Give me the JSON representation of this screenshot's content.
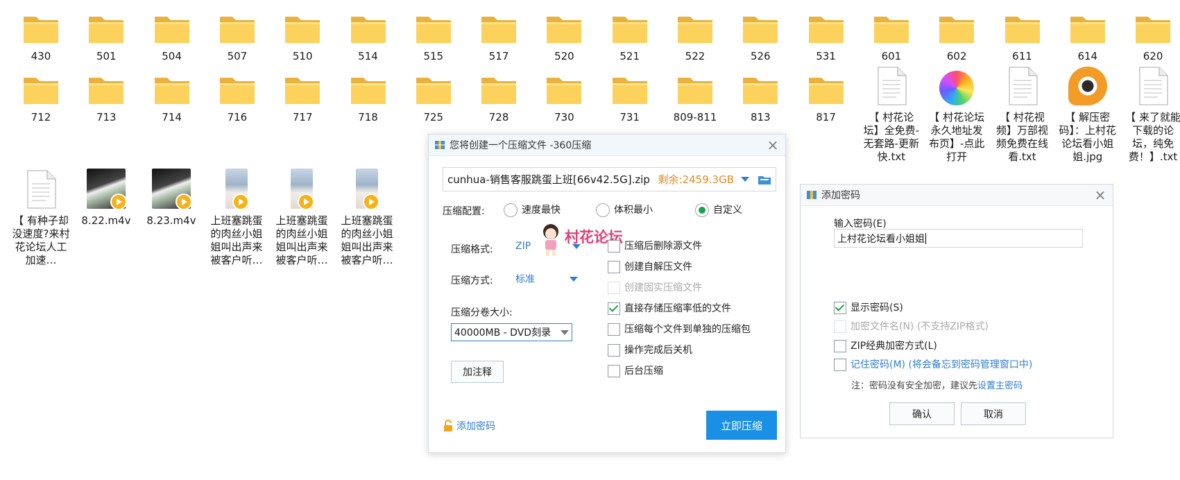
{
  "desktop": {
    "row1": [
      "430",
      "501",
      "504",
      "507",
      "510",
      "514",
      "515",
      "517",
      "520",
      "521",
      "522",
      "526",
      "531",
      "601",
      "602",
      "611",
      "614",
      "620"
    ],
    "row2_folders": [
      "712",
      "713",
      "714",
      "716",
      "717",
      "718",
      "725",
      "728",
      "730",
      "731",
      "809-811",
      "813",
      "817"
    ],
    "row2_files": [
      {
        "label": "【 村花论坛】全免费-无套路-更新快.txt",
        "icon": "text-file-icon"
      },
      {
        "label": "【 村花论坛永久地址发布页】-点此打开",
        "icon": "pinwheel-app-icon"
      },
      {
        "label": "【 村花视频】万部视频免费在线看.txt",
        "icon": "text-file-icon"
      },
      {
        "label": "【 解压密码】：上村花论坛看小姐姐.jpg",
        "icon": "eye-image-icon"
      },
      {
        "label": "【 来了就能下载的论坛，纯免费！】.txt",
        "icon": "text-file-icon"
      }
    ],
    "row3": [
      {
        "label": "【 有种子却没速度?来村花论坛人工加速…",
        "icon": "text-file-icon"
      },
      {
        "label": "8.22.m4v",
        "icon": "video-thumbnail"
      },
      {
        "label": "8.23.m4v",
        "icon": "video-thumbnail"
      },
      {
        "label": "上班塞跳蛋的肉丝小姐姐叫出声来被客户听…",
        "icon": "video-thumbnail"
      },
      {
        "label": "上班塞跳蛋的肉丝小姐姐叫出声来被客户听…",
        "icon": "video-thumbnail"
      },
      {
        "label": "上班塞跳蛋的肉丝小姐姐叫出声来被客户听…",
        "icon": "video-thumbnail"
      }
    ]
  },
  "compress": {
    "title": "您将创建一个压缩文件 -360压缩",
    "filename": "cunhua-销售客服跳蛋上班[66v42.5G].zip",
    "free_space": "剩余:2459.3GB",
    "config_label": "压缩配置:",
    "radio_fastest": "速度最快",
    "radio_smallest": "体积最小",
    "radio_custom": "自定义",
    "format_label": "压缩格式:",
    "format_value": "ZIP",
    "method_label": "压缩方式:",
    "method_value": "标准",
    "volume_label": "压缩分卷大小:",
    "volume_value": "40000MB  - DVD刻录",
    "comment_button": "加注释",
    "brand_watermark": "村花论坛",
    "options": [
      {
        "label": "压缩后删除源文件",
        "checked": false,
        "disabled": false
      },
      {
        "label": "创建自解压文件",
        "checked": false,
        "disabled": false
      },
      {
        "label": "创建固实压缩文件",
        "checked": false,
        "disabled": true
      },
      {
        "label": "直接存储压缩率低的文件",
        "checked": true,
        "disabled": false
      },
      {
        "label": "压缩每个文件到单独的压缩包",
        "checked": false,
        "disabled": false
      },
      {
        "label": "操作完成后关机",
        "checked": false,
        "disabled": false
      },
      {
        "label": "后台压缩",
        "checked": false,
        "disabled": false
      }
    ],
    "add_password_link": "添加密码",
    "start_button": "立即压缩",
    "accent": "#1a8fe6",
    "free_color": "#e58a23"
  },
  "password": {
    "title": "添加密码",
    "input_label": "输入密码(E)",
    "input_value": "上村花论坛看小姐姐",
    "show_password": "显示密码(S)",
    "encrypt_names": "加密文件名(N) (不支持ZIP格式)",
    "zip_classic": "ZIP经典加密方式(L)",
    "remember": "记住密码(M) (将会备忘到密码管理窗口中)",
    "note": "注：密码没有安全加密，建议先",
    "note_link": "设置主密码",
    "ok_button": "确认",
    "cancel_button": "取消"
  }
}
